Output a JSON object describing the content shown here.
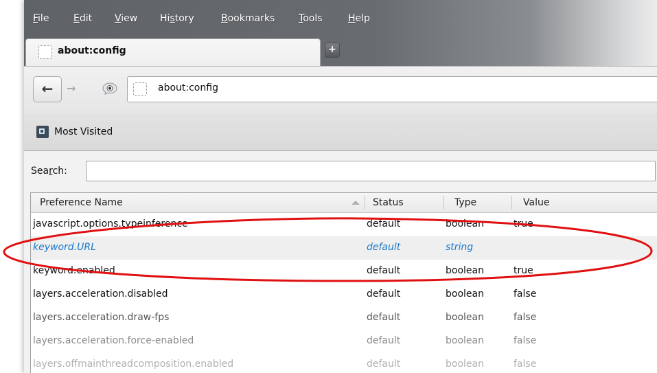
{
  "menu": {
    "items": [
      {
        "label": "File",
        "accel": "F",
        "rest": "ile"
      },
      {
        "label": "Edit",
        "accel": "E",
        "rest": "dit"
      },
      {
        "label": "View",
        "accel": "V",
        "rest": "iew"
      },
      {
        "label": "History",
        "accel": "s",
        "pre": "Hi",
        "rest": "tory"
      },
      {
        "label": "Bookmarks",
        "accel": "B",
        "rest": "ookmarks"
      },
      {
        "label": "Tools",
        "accel": "T",
        "rest": "ools"
      },
      {
        "label": "Help",
        "accel": "H",
        "rest": "elp"
      }
    ]
  },
  "tab": {
    "title": "about:config",
    "new_tab_symbol": "+"
  },
  "nav": {
    "back_symbol": "←",
    "forward_symbol": "→",
    "url": "about:config"
  },
  "bookmarks": {
    "most_visited": "Most Visited"
  },
  "search": {
    "label_pre": "Sea",
    "label_accel": "r",
    "label_post": "ch:",
    "value": ""
  },
  "table": {
    "columns": {
      "name": "Preference Name",
      "status": "Status",
      "type": "Type",
      "value": "Value"
    },
    "rows": [
      {
        "name": "javascript.options.typeinference",
        "status": "default",
        "type": "boolean",
        "value": "true"
      },
      {
        "name": "keyword.URL",
        "status": "default",
        "type": "string",
        "value": ""
      },
      {
        "name": "keyword.enabled",
        "status": "default",
        "type": "boolean",
        "value": "true"
      },
      {
        "name": "layers.acceleration.disabled",
        "status": "default",
        "type": "boolean",
        "value": "false"
      },
      {
        "name": "layers.acceleration.draw-fps",
        "status": "default",
        "type": "boolean",
        "value": "false"
      },
      {
        "name": "layers.acceleration.force-enabled",
        "status": "default",
        "type": "boolean",
        "value": "false"
      },
      {
        "name": "layers.offmainthreadcomposition.enabled",
        "status": "default",
        "type": "boolean",
        "value": "false"
      }
    ]
  },
  "colors": {
    "highlight_text": "#1a77c9",
    "annotation_ellipse": "#e01010"
  }
}
